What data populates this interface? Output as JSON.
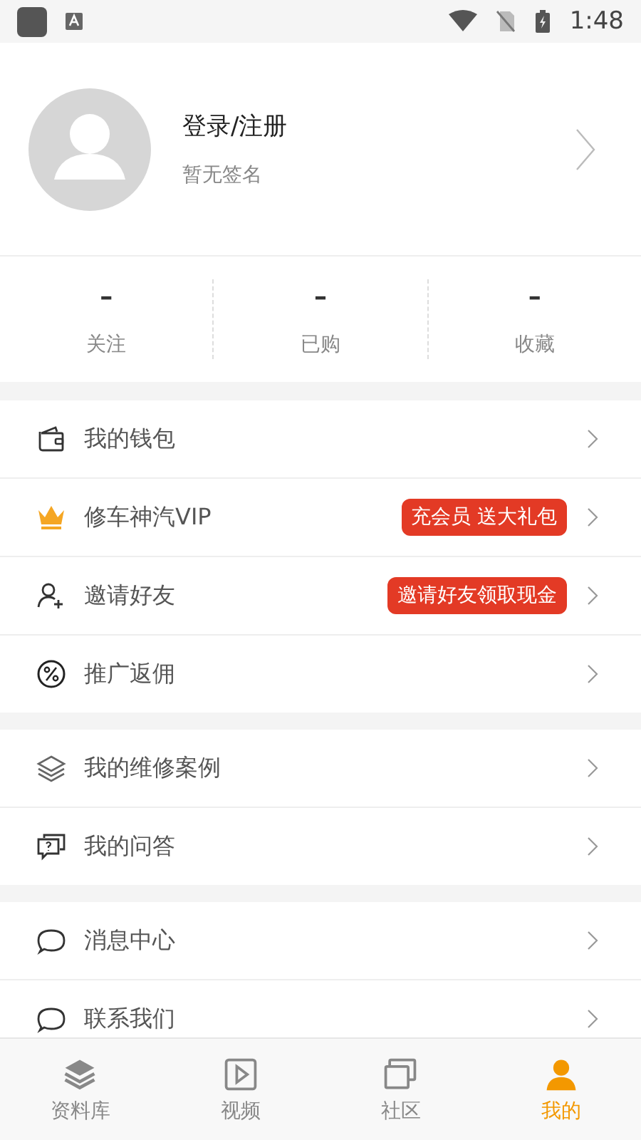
{
  "status_bar": {
    "time": "1:48"
  },
  "profile": {
    "title": "登录/注册",
    "subtitle": "暂无签名"
  },
  "stats": [
    {
      "value": "–",
      "label": "关注"
    },
    {
      "value": "–",
      "label": "已购"
    },
    {
      "value": "–",
      "label": "收藏"
    }
  ],
  "menu_groups": [
    [
      {
        "label": "我的钱包"
      },
      {
        "label": "修车神汽VIP",
        "badge": "充会员 送大礼包"
      },
      {
        "label": "邀请好友",
        "badge": "邀请好友领取现金"
      },
      {
        "label": "推广返佣"
      }
    ],
    [
      {
        "label": "我的维修案例"
      },
      {
        "label": "我的问答"
      }
    ],
    [
      {
        "label": "消息中心"
      },
      {
        "label": "联系我们"
      }
    ]
  ],
  "tabs": [
    {
      "label": "资料库",
      "selected": false
    },
    {
      "label": "视频",
      "selected": false
    },
    {
      "label": "社区",
      "selected": false
    },
    {
      "label": "我的",
      "selected": true
    }
  ]
}
